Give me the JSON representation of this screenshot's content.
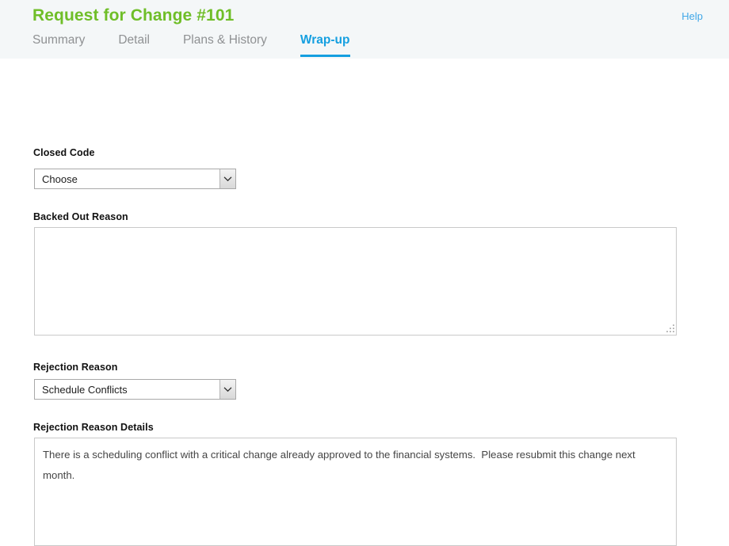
{
  "header": {
    "title": "Request for Change #101",
    "help_label": "Help",
    "title_color": "#6fbe28",
    "accent_color": "#149fe0",
    "background": "#f4f7f8",
    "tabs": [
      {
        "label": "Summary",
        "active": false
      },
      {
        "label": "Detail",
        "active": false
      },
      {
        "label": "Plans & History",
        "active": false
      },
      {
        "label": "Wrap-up",
        "active": true
      }
    ]
  },
  "form": {
    "closed_code": {
      "label": "Closed Code",
      "value": "Choose",
      "icon": "chevron-down-icon"
    },
    "backed_out_reason": {
      "label": "Backed Out Reason",
      "value": ""
    },
    "rejection_reason": {
      "label": "Rejection Reason",
      "value": "Schedule Conflicts",
      "icon": "chevron-down-icon"
    },
    "rejection_reason_details": {
      "label": "Rejection Reason Details",
      "value": "There is a scheduling conflict with a critical change already approved to the financial systems.  Please resubmit this change next month."
    }
  }
}
